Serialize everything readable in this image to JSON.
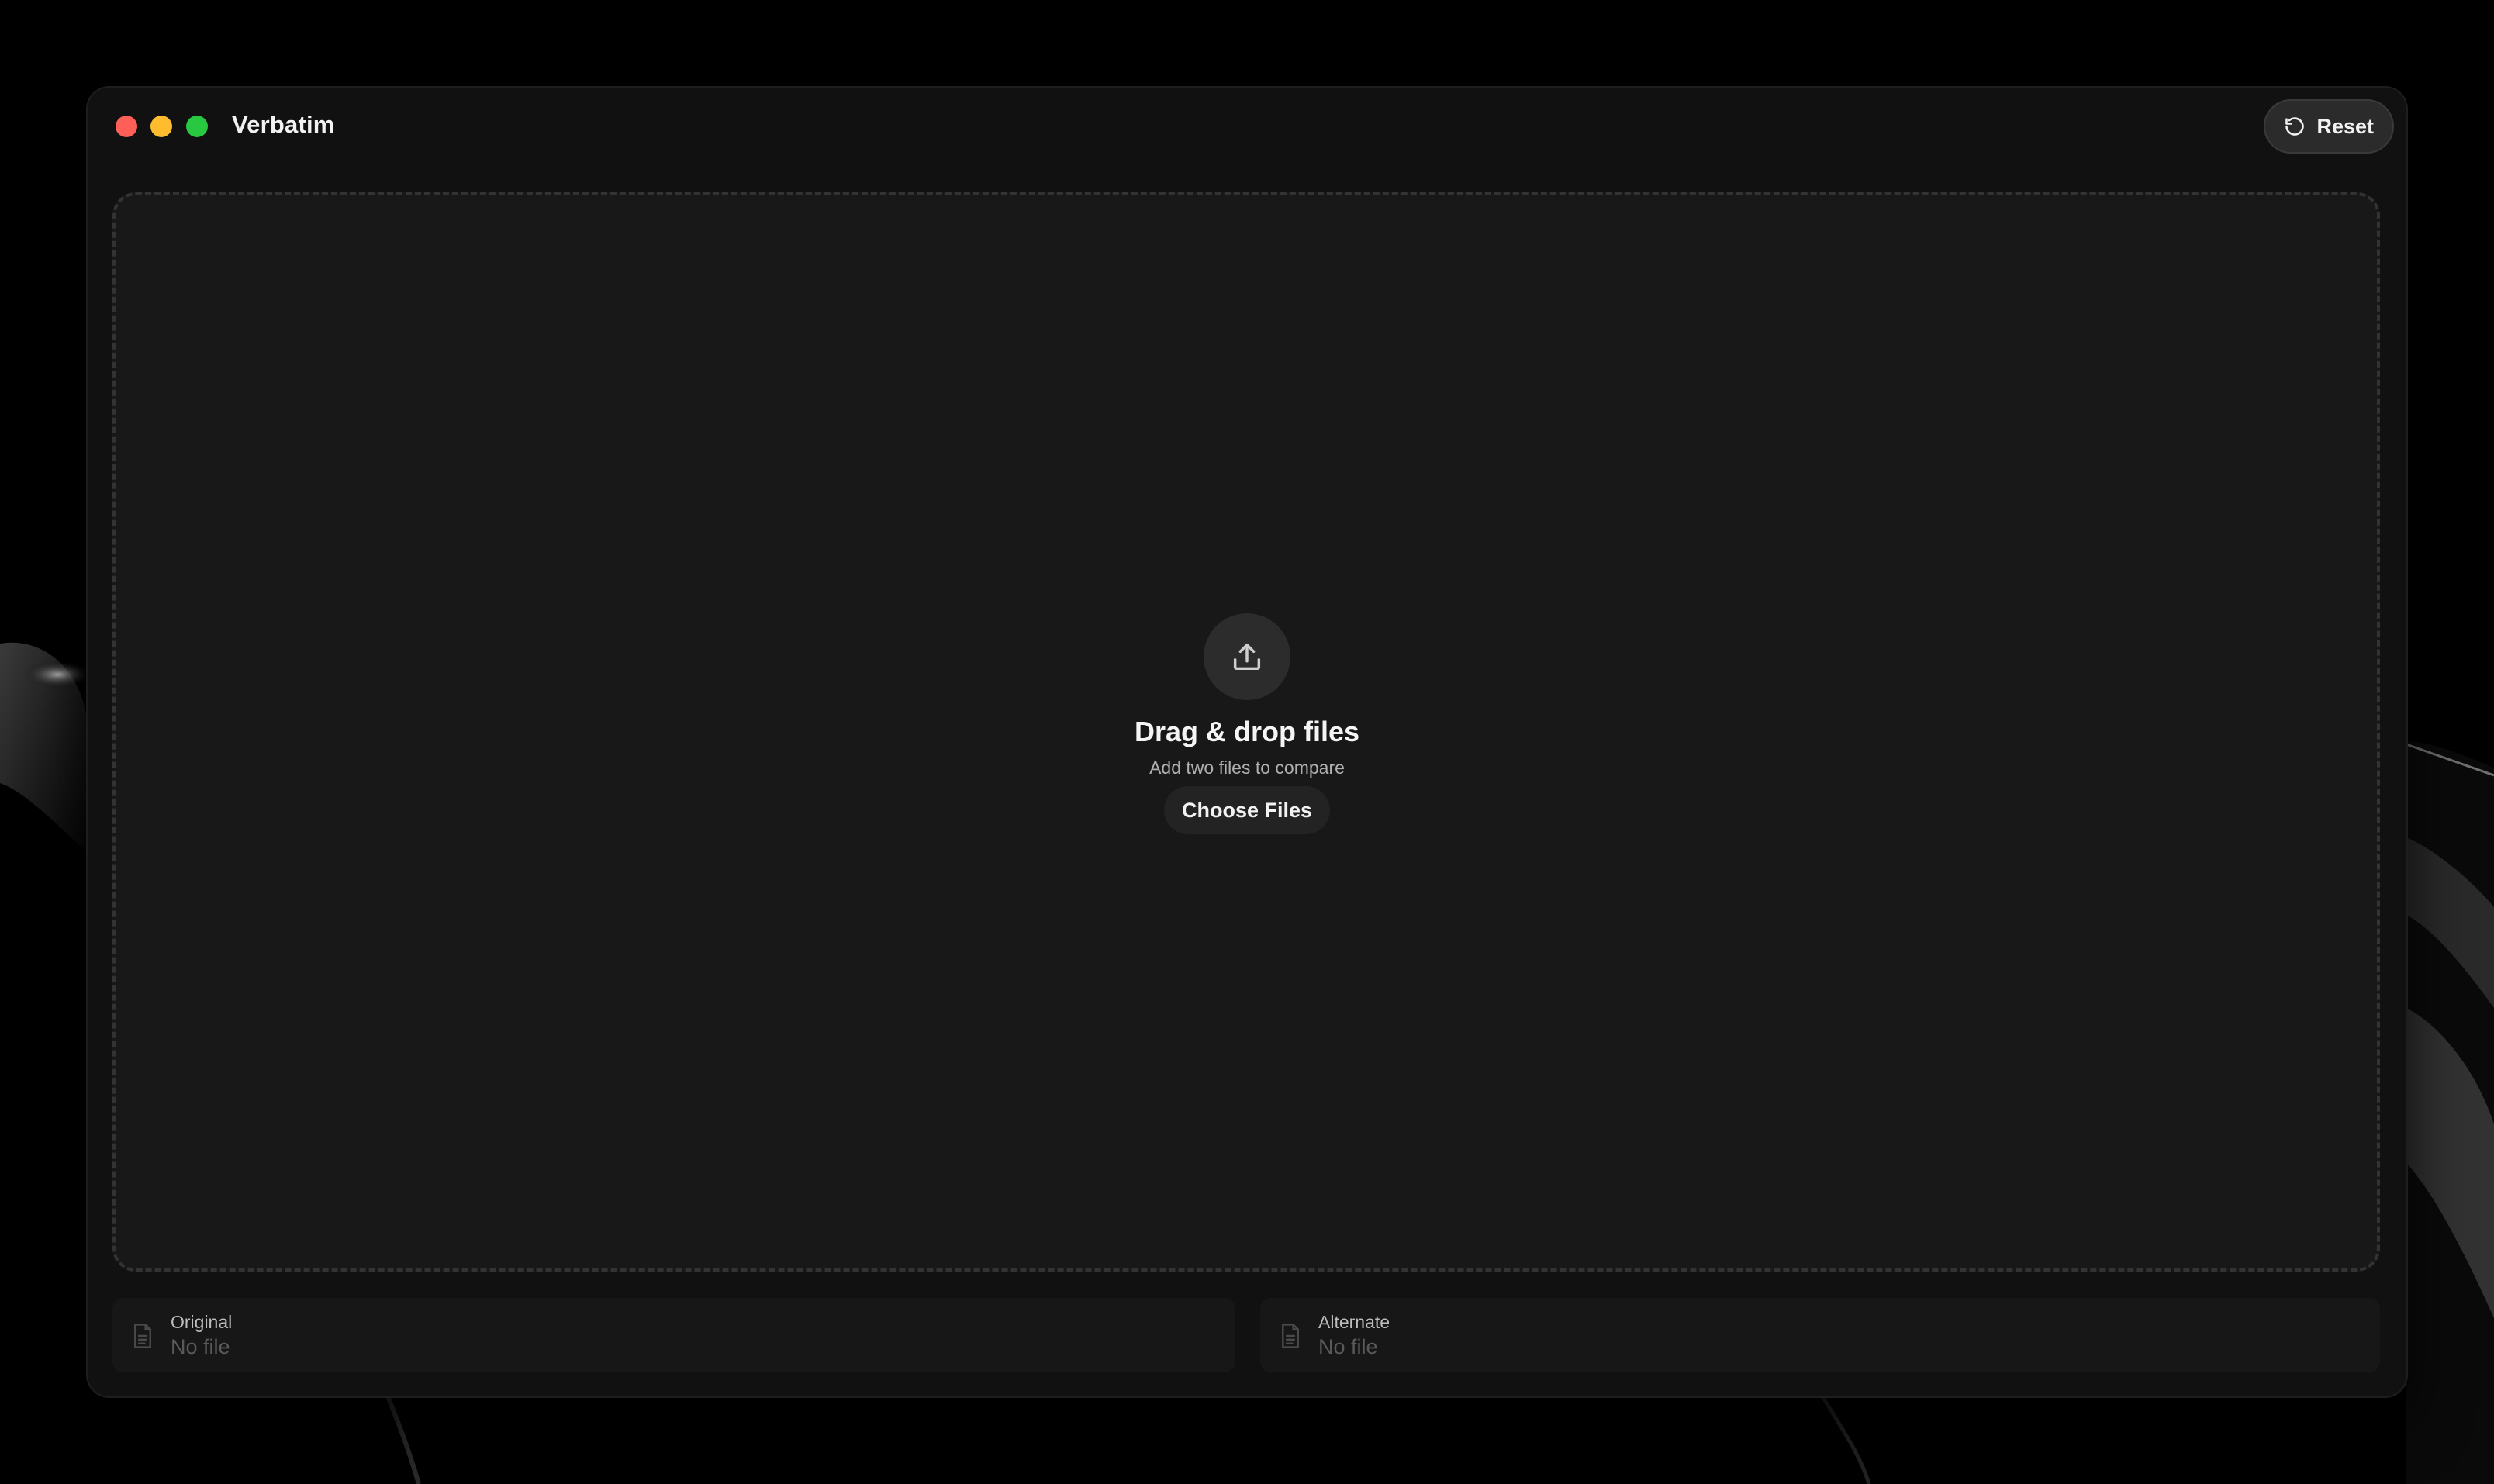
{
  "window": {
    "title": "Verbatim"
  },
  "toolbar": {
    "reset_label": "Reset",
    "reset_icon": "reset-icon"
  },
  "dropzone": {
    "icon": "upload-icon",
    "title": "Drag & drop files",
    "subtitle": "Add two files to compare",
    "choose_label": "Choose Files"
  },
  "files": {
    "original": {
      "label": "Original",
      "value": "No file",
      "icon": "file-icon"
    },
    "alternate": {
      "label": "Alternate",
      "value": "No file",
      "icon": "file-icon"
    }
  },
  "colors": {
    "close": "#fe5f57",
    "minimize": "#febc2e",
    "zoom": "#28c840",
    "window_bg": "#111111",
    "dropzone_bg": "#181818"
  }
}
